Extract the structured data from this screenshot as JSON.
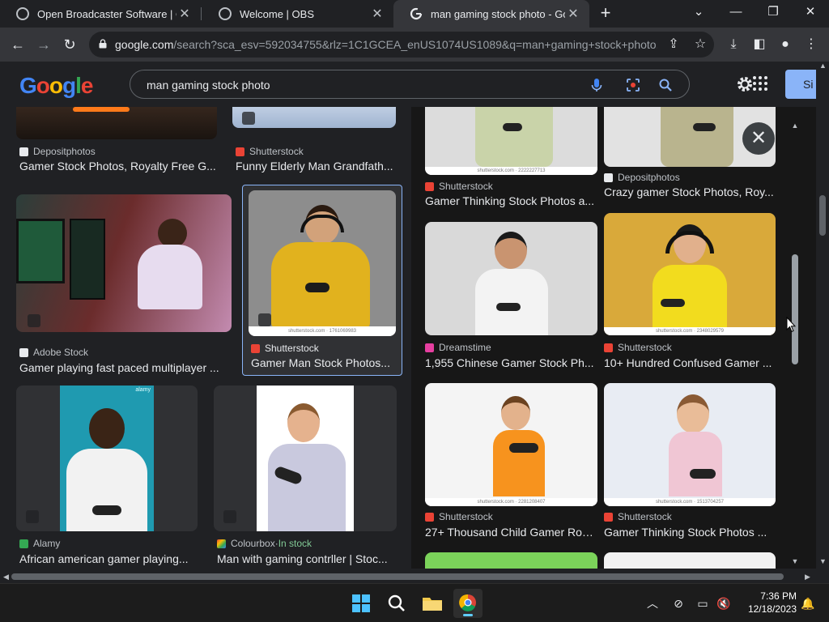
{
  "browser": {
    "tabs": [
      {
        "title": "Open Broadcaster Software | OBS",
        "active": false
      },
      {
        "title": "Welcome | OBS",
        "active": false
      },
      {
        "title": "man gaming stock photo - Google Search",
        "active": true
      }
    ],
    "new_tab_label": "+",
    "url_domain": "google.com",
    "url_path": "/search?sca_esv=592034755&rlz=1C1GCEA_enUS1074US1089&q=man+gaming+stock+photo..."
  },
  "google": {
    "logo_letters": [
      "G",
      "o",
      "o",
      "g",
      "l",
      "e"
    ],
    "search_query": "man gaming stock photo",
    "signin_label": "Si"
  },
  "results": [
    {
      "source": "Depositphotos",
      "caption": "Gamer Stock Photos, Royalty Free G...",
      "source_color": "#e8eaed"
    },
    {
      "source": "Shutterstock",
      "caption": "Funny Elderly Man Grandfath...",
      "source_color": "#ea4335"
    },
    {
      "source": "Adobe Stock",
      "caption": "Gamer playing fast paced multiplayer ...",
      "source_color": "#e8eaed"
    },
    {
      "source": "Shutterstock",
      "caption": "Gamer Man Stock Photos...",
      "source_color": "#ea4335",
      "watermark": "shutterstock.com · 1761069983"
    },
    {
      "source": "Alamy",
      "caption": "African american gamer playing...",
      "source_color": "#34a853",
      "watermark": "alamy"
    },
    {
      "source": "Colourbox",
      "source_suffix": " · ",
      "stock": "In stock",
      "caption": "Man with gaming contrller | Stoc...",
      "source_color": "#fbbc05"
    }
  ],
  "panel": {
    "items": [
      {
        "source": "Shutterstock",
        "caption": "Gamer Thinking Stock Photos a...",
        "watermark": "shutterstock.com · 2222227713"
      },
      {
        "source": "Depositphotos",
        "caption": "Crazy gamer Stock Photos, Roy..."
      },
      {
        "source": "Dreamstime",
        "caption": "1,955 Chinese Gamer Stock Ph..."
      },
      {
        "source": "Shutterstock",
        "caption": "10+ Hundred Confused Gamer ...",
        "watermark": "shutterstock.com · 2348029579"
      },
      {
        "source": "Shutterstock",
        "caption": "27+ Thousand Child Gamer Roy...",
        "watermark": "shutterstock.com · 2281208407"
      },
      {
        "source": "Shutterstock",
        "caption": "Gamer Thinking Stock Photos ...",
        "watermark": "shutterstock.com · 1513704257"
      }
    ]
  },
  "taskbar": {
    "time": "7:36 PM",
    "date": "12/18/2023"
  }
}
